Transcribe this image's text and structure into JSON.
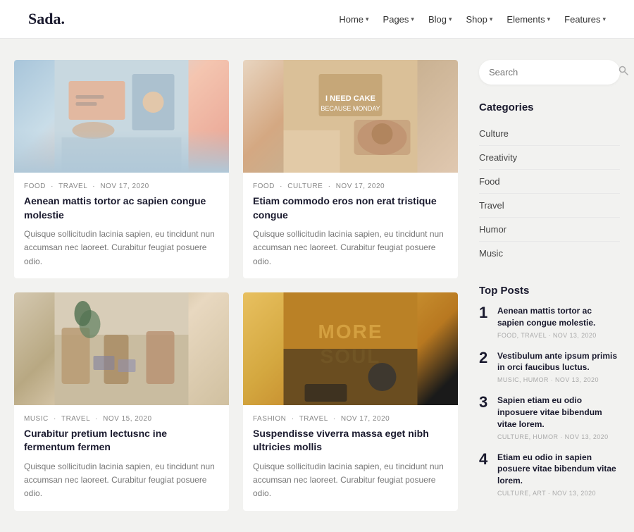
{
  "header": {
    "logo": "Sada.",
    "nav_items": [
      {
        "label": "Home",
        "has_dropdown": true
      },
      {
        "label": "Pages",
        "has_dropdown": true
      },
      {
        "label": "Blog",
        "has_dropdown": true
      },
      {
        "label": "Shop",
        "has_dropdown": true
      },
      {
        "label": "Elements",
        "has_dropdown": true
      },
      {
        "label": "Features",
        "has_dropdown": true
      }
    ]
  },
  "search": {
    "placeholder": "Search"
  },
  "sidebar": {
    "categories_title": "Categories",
    "categories": [
      {
        "label": "Culture"
      },
      {
        "label": "Creativity"
      },
      {
        "label": "Food"
      },
      {
        "label": "Travel"
      },
      {
        "label": "Humor"
      },
      {
        "label": "Music"
      }
    ],
    "top_posts_title": "Top Posts",
    "top_posts": [
      {
        "number": "1",
        "title": "Aenean mattis tortor ac sapien congue molestie.",
        "meta": "FOOD, TRAVEL",
        "date": "NOV 13, 2020"
      },
      {
        "number": "2",
        "title": "Vestibulum ante ipsum primis in orci faucibus luctus.",
        "meta": "MUSIC, HUMOR",
        "date": "NOV 13, 2020"
      },
      {
        "number": "3",
        "title": "Sapien etiam eu odio inposuere vitae bibendum vitae lorem.",
        "meta": "CULTURE, HUMOR",
        "date": "NOV 13, 2020"
      },
      {
        "number": "4",
        "title": "Etiam eu odio in sapien posuere vitae bibendum vitae lorem.",
        "meta": "CULTURE, ART",
        "date": "NOV 13, 2020"
      }
    ]
  },
  "posts": [
    {
      "meta_tag1": "FOOD",
      "meta_tag2": "TRAVEL",
      "date": "NOV 17, 2020",
      "title": "Aenean mattis tortor ac sapien congue molestie",
      "excerpt": "Quisque sollicitudin lacinia sapien, eu tincidunt nun accumsan nec laoreet. Curabitur feugiat posuere odio.",
      "img_class": "img-1"
    },
    {
      "meta_tag1": "FOOD",
      "meta_tag2": "CULTURE",
      "date": "NOV 17, 2020",
      "title": "Etiam commodo eros non erat tristique congue",
      "excerpt": "Quisque sollicitudin lacinia sapien, eu tincidunt nun accumsan nec laoreet. Curabitur feugiat posuere odio.",
      "img_class": "img-2"
    },
    {
      "meta_tag1": "MUSIC",
      "meta_tag2": "TRAVEL",
      "date": "NOV 15, 2020",
      "title": "Curabitur pretium lectusnc ine fermentum fermen",
      "excerpt": "Quisque sollicitudin lacinia sapien, eu tincidunt nun accumsan nec laoreet. Curabitur feugiat posuere odio.",
      "img_class": "img-3"
    },
    {
      "meta_tag1": "FASHION",
      "meta_tag2": "TRAVEL",
      "date": "NOV 17, 2020",
      "title": "Suspendisse viverra massa eget nibh ultricies mollis",
      "excerpt": "Quisque sollicitudin lacinia sapien, eu tincidunt nun accumsan nec laoreet. Curabitur feugiat posuere odio.",
      "img_class": "img-4"
    }
  ]
}
